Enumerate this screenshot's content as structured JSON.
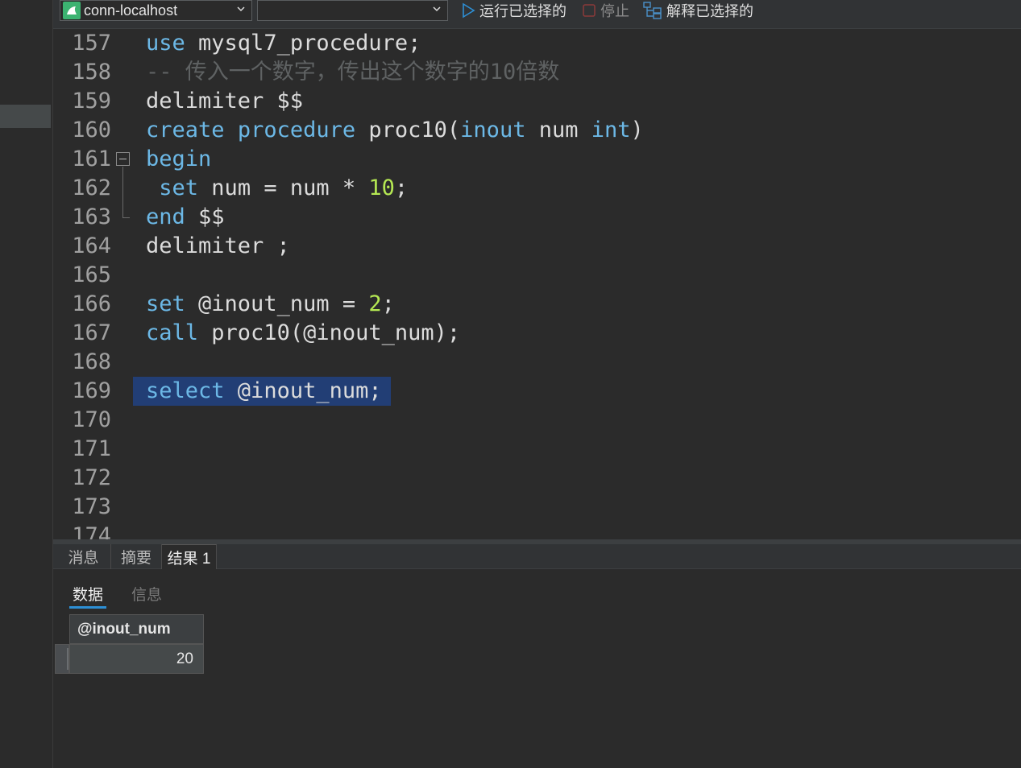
{
  "toolbar": {
    "connection": "conn-localhost",
    "database": "",
    "run_selected_label": "运行已选择的",
    "stop_label": "停止",
    "explain_selected_label": "解释已选择的"
  },
  "editor": {
    "lines": [
      {
        "n": "157",
        "code": "use mysql7_procedure;"
      },
      {
        "n": "158",
        "code": "-- 传入一个数字，传出这个数字的10倍数"
      },
      {
        "n": "159",
        "code": "delimiter $$"
      },
      {
        "n": "160",
        "code": "create procedure proc10(inout num int)"
      },
      {
        "n": "161",
        "code": "begin"
      },
      {
        "n": "162",
        "code": " set num = num * 10;"
      },
      {
        "n": "163",
        "code": "end $$"
      },
      {
        "n": "164",
        "code": "delimiter ;"
      },
      {
        "n": "165",
        "code": ""
      },
      {
        "n": "166",
        "code": "set @inout_num = 2;"
      },
      {
        "n": "167",
        "code": "call proc10(@inout_num);"
      },
      {
        "n": "168",
        "code": ""
      },
      {
        "n": "169",
        "code": "select @inout_num;"
      },
      {
        "n": "170",
        "code": ""
      },
      {
        "n": "171",
        "code": ""
      },
      {
        "n": "172",
        "code": ""
      },
      {
        "n": "173",
        "code": ""
      },
      {
        "n": "174",
        "code": ""
      }
    ]
  },
  "results": {
    "tabs": [
      "消息",
      "摘要",
      "结果 1"
    ],
    "active_tab": "结果 1",
    "subtabs": [
      "数据",
      "信息"
    ],
    "active_subtab": "数据",
    "columns": [
      "@inout_num"
    ],
    "rows": [
      [
        "20"
      ]
    ]
  },
  "colors": {
    "keyword": "#6cb8e6",
    "number": "#b5e853",
    "comment": "#5f6263",
    "selection": "#214283",
    "accent": "#2d8fd5"
  }
}
